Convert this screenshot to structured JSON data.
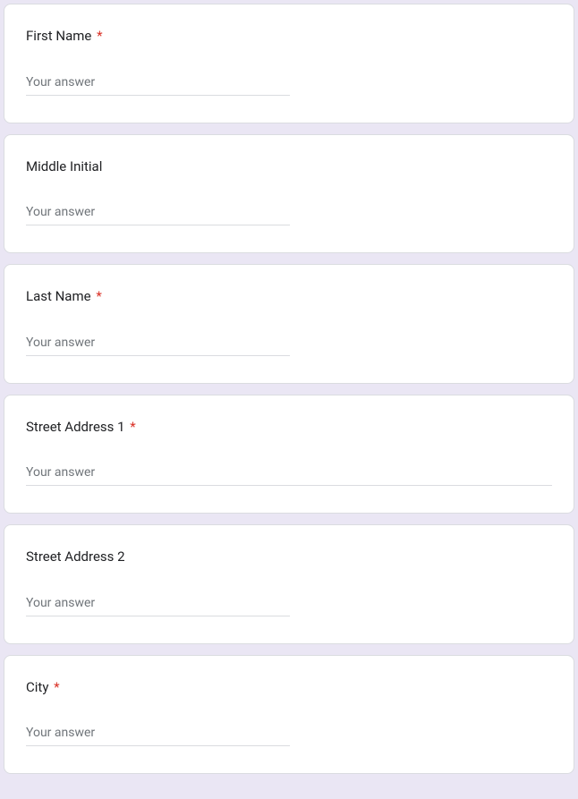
{
  "fields": [
    {
      "label": "First Name",
      "required": true,
      "placeholder": "Your answer",
      "width": "short"
    },
    {
      "label": "Middle Initial",
      "required": false,
      "placeholder": "Your answer",
      "width": "short"
    },
    {
      "label": "Last Name",
      "required": true,
      "placeholder": "Your answer",
      "width": "short"
    },
    {
      "label": "Street Address 1",
      "required": true,
      "placeholder": "Your answer",
      "width": "long"
    },
    {
      "label": "Street Address 2",
      "required": false,
      "placeholder": "Your answer",
      "width": "short"
    },
    {
      "label": "City",
      "required": true,
      "placeholder": "Your answer",
      "width": "short"
    }
  ],
  "required_marker": "*"
}
